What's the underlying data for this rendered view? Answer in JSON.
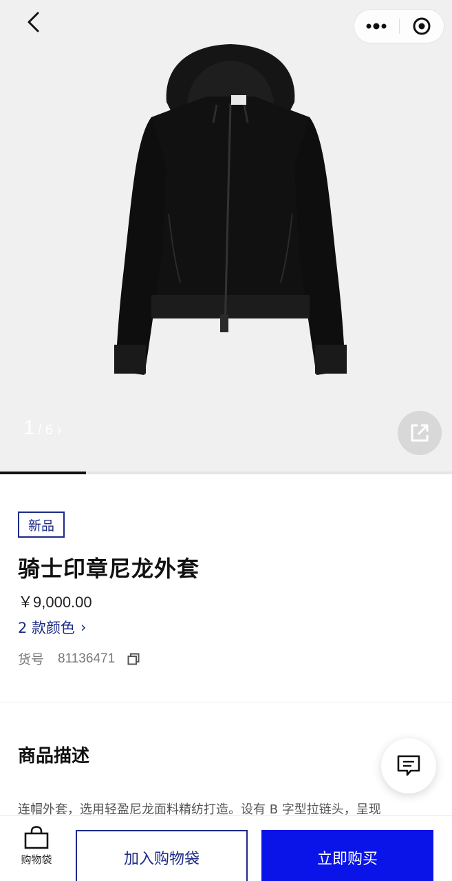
{
  "gallery": {
    "current_page": "1",
    "total_pages": "/ 6",
    "next_chevron": "›",
    "progress_fraction": 0.19,
    "icons": {
      "back": "chevron-left-icon",
      "more": "more-dots-icon",
      "close_mini": "record-circle-icon",
      "share": "share-external-icon"
    }
  },
  "product": {
    "badge": "新品",
    "title": "骑士印章尼龙外套",
    "price": "￥9,000.00",
    "colors_link": "2 款颜色",
    "colors_chevron": "›",
    "sku_label": "货号",
    "sku_value": "81136471"
  },
  "description": {
    "heading": "商品描述",
    "text": "连帽外套，选用轻盈尼龙面料精纺打造。设有 B 字型拉链头，呈现"
  },
  "bottom_bar": {
    "bag_label": "购物袋",
    "add_to_bag": "加入购物袋",
    "buy_now": "立即购买"
  },
  "colors": {
    "accent_navy": "#1c2a87",
    "buy_blue": "#0a14e8",
    "gallery_bg": "#f0f0f0"
  }
}
